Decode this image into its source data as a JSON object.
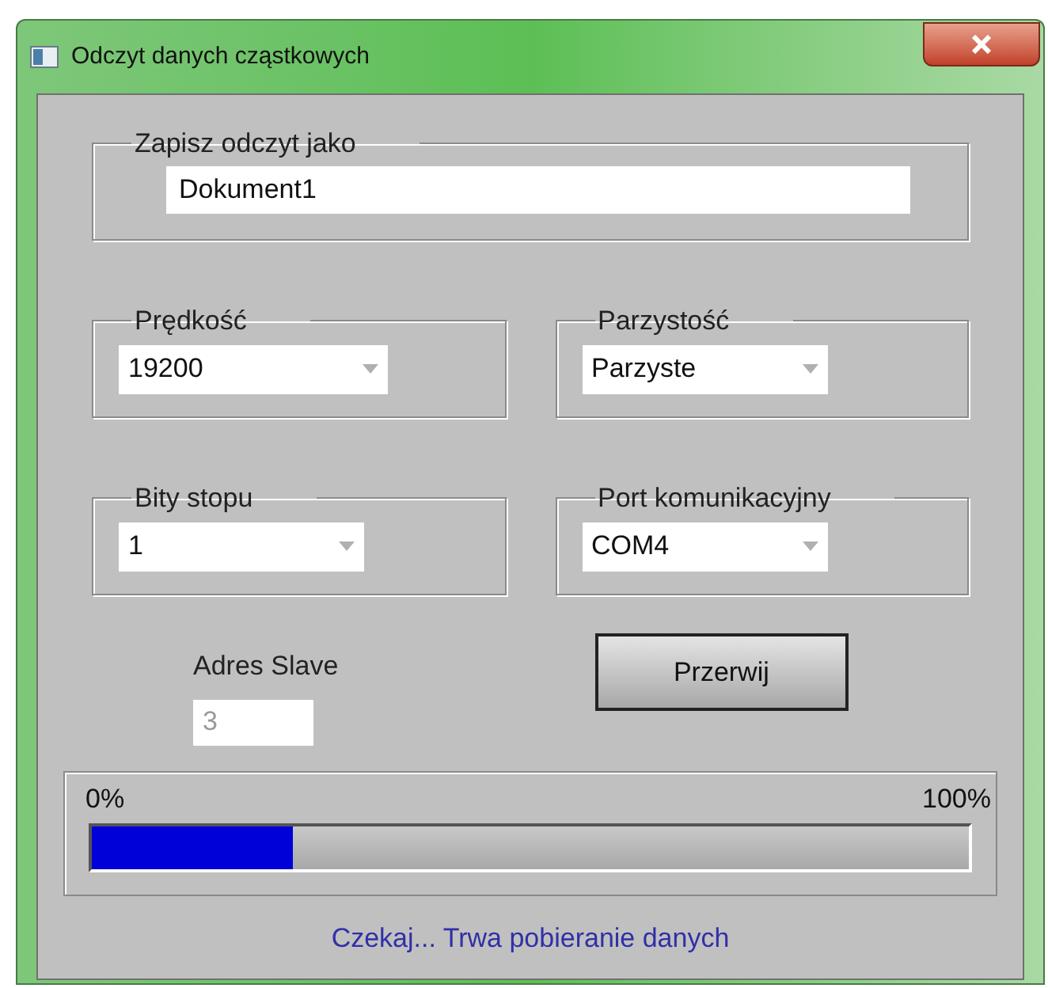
{
  "window": {
    "title": "Odczyt danych cząstkowych"
  },
  "save_group": {
    "label": "Zapisz odczyt jako",
    "value": "Dokument1"
  },
  "combos": [
    {
      "label": "Prędkość",
      "value": "19200"
    },
    {
      "label": "Parzystość",
      "value": "Parzyste"
    },
    {
      "label": "Bity stopu",
      "value": "1"
    },
    {
      "label": "Port komunikacyjny",
      "value": "COM4"
    }
  ],
  "slave_address": {
    "label": "Adres Slave",
    "value": "3",
    "disabled": true
  },
  "abort_button": {
    "label": "Przerwij"
  },
  "progress": {
    "min_label": "0%",
    "max_label": "100%",
    "level": 0.23
  },
  "status": "Czekaj... Trwa pobieranie danych"
}
